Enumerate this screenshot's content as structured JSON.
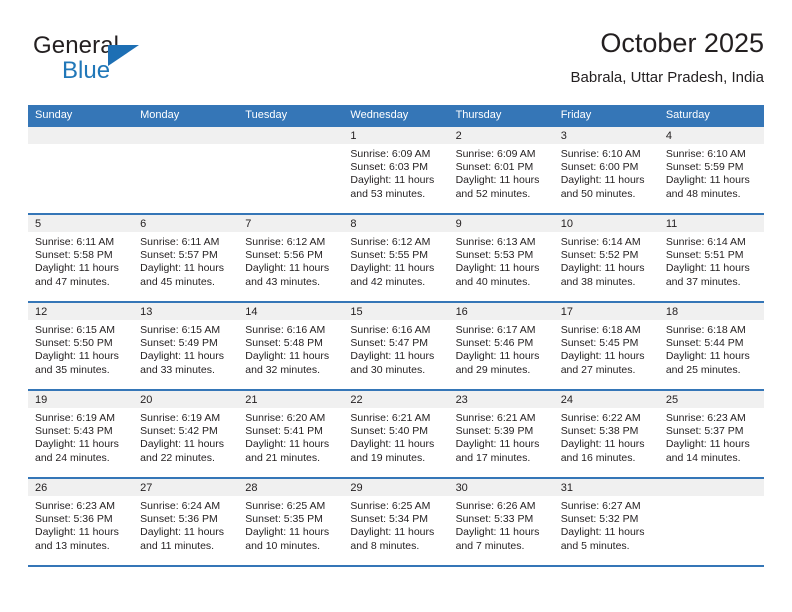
{
  "brand": {
    "name_top": "General",
    "name_bottom": "Blue",
    "accent_color": "#1d6fb4",
    "text_color": "#231f20"
  },
  "header": {
    "title": "October 2025",
    "subtitle": "Babrala, Uttar Pradesh, India"
  },
  "theme": {
    "header_row_bg": "#3576b7",
    "header_row_text": "#ffffff",
    "daynum_bg": "#f0f0f0",
    "row_border": "#3576b7",
    "body_text": "#231f20"
  },
  "calendar": {
    "day_headers": [
      "Sunday",
      "Monday",
      "Tuesday",
      "Wednesday",
      "Thursday",
      "Friday",
      "Saturday"
    ],
    "labels": {
      "sunrise": "Sunrise:",
      "sunset": "Sunset:",
      "daylight": "Daylight:"
    },
    "weeks": [
      [
        {
          "day": "",
          "l1": "",
          "l2": "",
          "l3": "",
          "l4": ""
        },
        {
          "day": "",
          "l1": "",
          "l2": "",
          "l3": "",
          "l4": ""
        },
        {
          "day": "",
          "l1": "",
          "l2": "",
          "l3": "",
          "l4": ""
        },
        {
          "day": "1",
          "l1": "Sunrise: 6:09 AM",
          "l2": "Sunset: 6:03 PM",
          "l3": "Daylight: 11 hours",
          "l4": "and 53 minutes."
        },
        {
          "day": "2",
          "l1": "Sunrise: 6:09 AM",
          "l2": "Sunset: 6:01 PM",
          "l3": "Daylight: 11 hours",
          "l4": "and 52 minutes."
        },
        {
          "day": "3",
          "l1": "Sunrise: 6:10 AM",
          "l2": "Sunset: 6:00 PM",
          "l3": "Daylight: 11 hours",
          "l4": "and 50 minutes."
        },
        {
          "day": "4",
          "l1": "Sunrise: 6:10 AM",
          "l2": "Sunset: 5:59 PM",
          "l3": "Daylight: 11 hours",
          "l4": "and 48 minutes."
        }
      ],
      [
        {
          "day": "5",
          "l1": "Sunrise: 6:11 AM",
          "l2": "Sunset: 5:58 PM",
          "l3": "Daylight: 11 hours",
          "l4": "and 47 minutes."
        },
        {
          "day": "6",
          "l1": "Sunrise: 6:11 AM",
          "l2": "Sunset: 5:57 PM",
          "l3": "Daylight: 11 hours",
          "l4": "and 45 minutes."
        },
        {
          "day": "7",
          "l1": "Sunrise: 6:12 AM",
          "l2": "Sunset: 5:56 PM",
          "l3": "Daylight: 11 hours",
          "l4": "and 43 minutes."
        },
        {
          "day": "8",
          "l1": "Sunrise: 6:12 AM",
          "l2": "Sunset: 5:55 PM",
          "l3": "Daylight: 11 hours",
          "l4": "and 42 minutes."
        },
        {
          "day": "9",
          "l1": "Sunrise: 6:13 AM",
          "l2": "Sunset: 5:53 PM",
          "l3": "Daylight: 11 hours",
          "l4": "and 40 minutes."
        },
        {
          "day": "10",
          "l1": "Sunrise: 6:14 AM",
          "l2": "Sunset: 5:52 PM",
          "l3": "Daylight: 11 hours",
          "l4": "and 38 minutes."
        },
        {
          "day": "11",
          "l1": "Sunrise: 6:14 AM",
          "l2": "Sunset: 5:51 PM",
          "l3": "Daylight: 11 hours",
          "l4": "and 37 minutes."
        }
      ],
      [
        {
          "day": "12",
          "l1": "Sunrise: 6:15 AM",
          "l2": "Sunset: 5:50 PM",
          "l3": "Daylight: 11 hours",
          "l4": "and 35 minutes."
        },
        {
          "day": "13",
          "l1": "Sunrise: 6:15 AM",
          "l2": "Sunset: 5:49 PM",
          "l3": "Daylight: 11 hours",
          "l4": "and 33 minutes."
        },
        {
          "day": "14",
          "l1": "Sunrise: 6:16 AM",
          "l2": "Sunset: 5:48 PM",
          "l3": "Daylight: 11 hours",
          "l4": "and 32 minutes."
        },
        {
          "day": "15",
          "l1": "Sunrise: 6:16 AM",
          "l2": "Sunset: 5:47 PM",
          "l3": "Daylight: 11 hours",
          "l4": "and 30 minutes."
        },
        {
          "day": "16",
          "l1": "Sunrise: 6:17 AM",
          "l2": "Sunset: 5:46 PM",
          "l3": "Daylight: 11 hours",
          "l4": "and 29 minutes."
        },
        {
          "day": "17",
          "l1": "Sunrise: 6:18 AM",
          "l2": "Sunset: 5:45 PM",
          "l3": "Daylight: 11 hours",
          "l4": "and 27 minutes."
        },
        {
          "day": "18",
          "l1": "Sunrise: 6:18 AM",
          "l2": "Sunset: 5:44 PM",
          "l3": "Daylight: 11 hours",
          "l4": "and 25 minutes."
        }
      ],
      [
        {
          "day": "19",
          "l1": "Sunrise: 6:19 AM",
          "l2": "Sunset: 5:43 PM",
          "l3": "Daylight: 11 hours",
          "l4": "and 24 minutes."
        },
        {
          "day": "20",
          "l1": "Sunrise: 6:19 AM",
          "l2": "Sunset: 5:42 PM",
          "l3": "Daylight: 11 hours",
          "l4": "and 22 minutes."
        },
        {
          "day": "21",
          "l1": "Sunrise: 6:20 AM",
          "l2": "Sunset: 5:41 PM",
          "l3": "Daylight: 11 hours",
          "l4": "and 21 minutes."
        },
        {
          "day": "22",
          "l1": "Sunrise: 6:21 AM",
          "l2": "Sunset: 5:40 PM",
          "l3": "Daylight: 11 hours",
          "l4": "and 19 minutes."
        },
        {
          "day": "23",
          "l1": "Sunrise: 6:21 AM",
          "l2": "Sunset: 5:39 PM",
          "l3": "Daylight: 11 hours",
          "l4": "and 17 minutes."
        },
        {
          "day": "24",
          "l1": "Sunrise: 6:22 AM",
          "l2": "Sunset: 5:38 PM",
          "l3": "Daylight: 11 hours",
          "l4": "and 16 minutes."
        },
        {
          "day": "25",
          "l1": "Sunrise: 6:23 AM",
          "l2": "Sunset: 5:37 PM",
          "l3": "Daylight: 11 hours",
          "l4": "and 14 minutes."
        }
      ],
      [
        {
          "day": "26",
          "l1": "Sunrise: 6:23 AM",
          "l2": "Sunset: 5:36 PM",
          "l3": "Daylight: 11 hours",
          "l4": "and 13 minutes."
        },
        {
          "day": "27",
          "l1": "Sunrise: 6:24 AM",
          "l2": "Sunset: 5:36 PM",
          "l3": "Daylight: 11 hours",
          "l4": "and 11 minutes."
        },
        {
          "day": "28",
          "l1": "Sunrise: 6:25 AM",
          "l2": "Sunset: 5:35 PM",
          "l3": "Daylight: 11 hours",
          "l4": "and 10 minutes."
        },
        {
          "day": "29",
          "l1": "Sunrise: 6:25 AM",
          "l2": "Sunset: 5:34 PM",
          "l3": "Daylight: 11 hours",
          "l4": "and 8 minutes."
        },
        {
          "day": "30",
          "l1": "Sunrise: 6:26 AM",
          "l2": "Sunset: 5:33 PM",
          "l3": "Daylight: 11 hours",
          "l4": "and 7 minutes."
        },
        {
          "day": "31",
          "l1": "Sunrise: 6:27 AM",
          "l2": "Sunset: 5:32 PM",
          "l3": "Daylight: 11 hours",
          "l4": "and 5 minutes."
        },
        {
          "day": "",
          "l1": "",
          "l2": "",
          "l3": "",
          "l4": ""
        }
      ]
    ]
  }
}
